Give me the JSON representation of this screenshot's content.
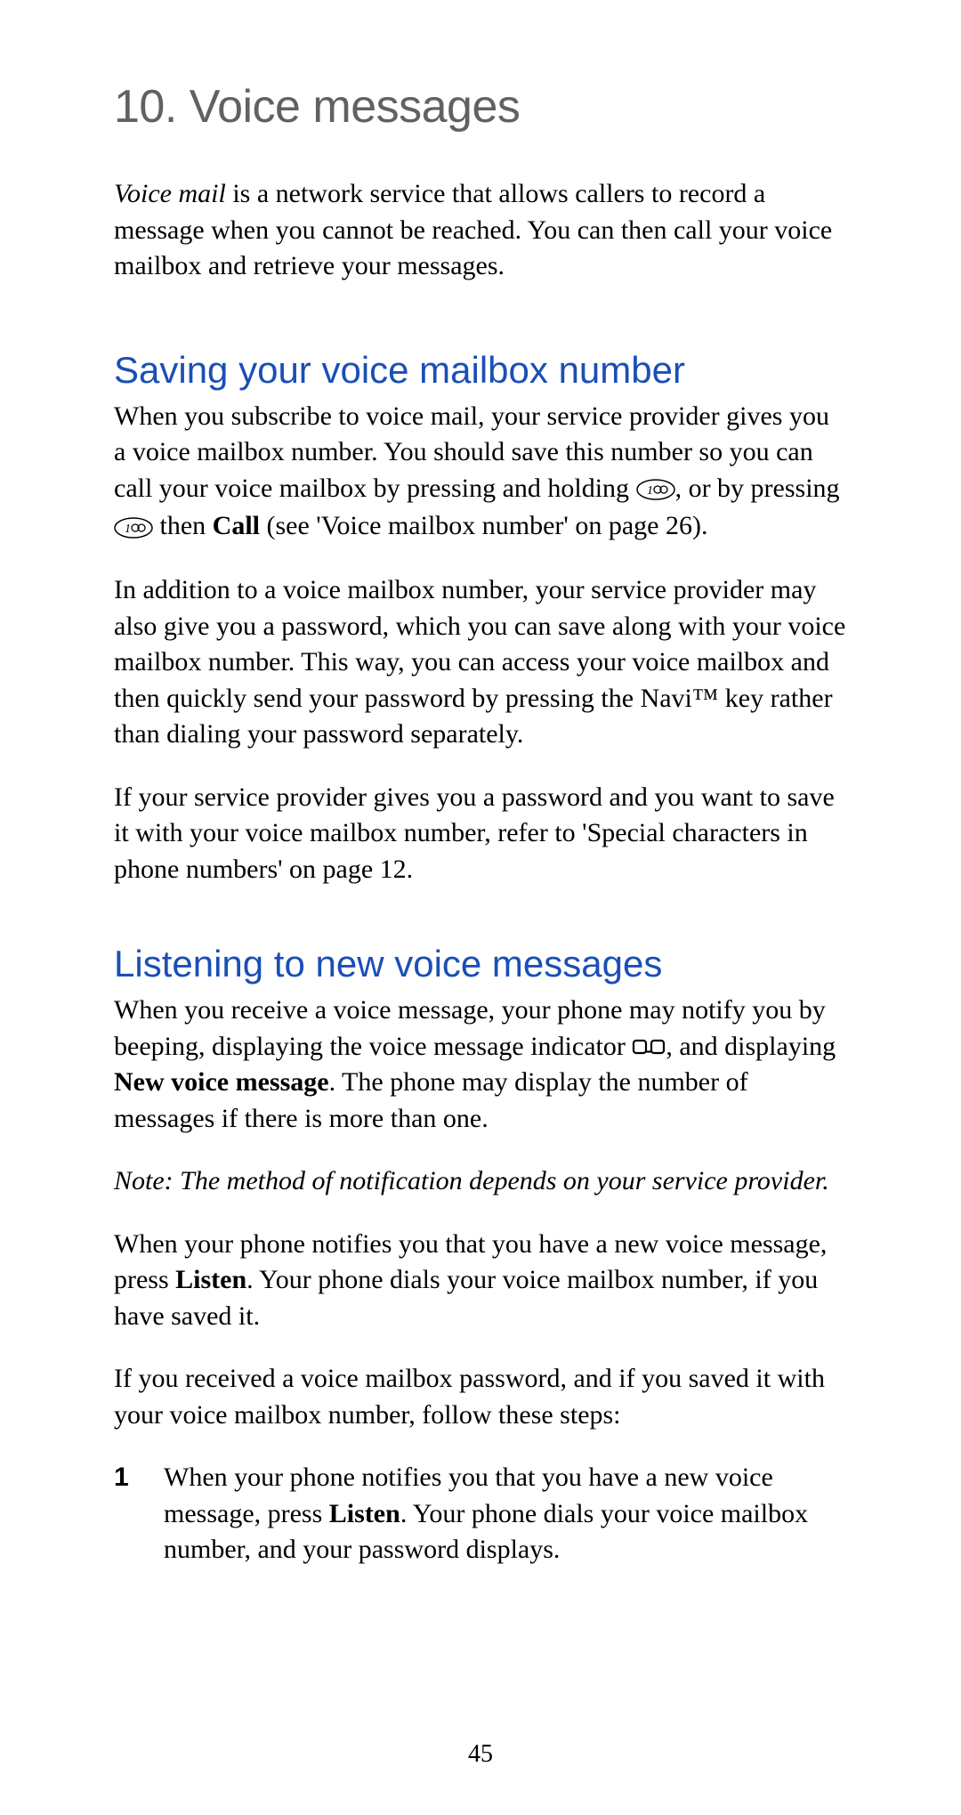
{
  "chapter": {
    "number": "10.",
    "title": "Voice messages"
  },
  "intro": {
    "em_prefix": "Voice mail",
    "text": " is a network service that allows callers to record a message when you cannot be reached. You can then call your voice mailbox and retrieve your messages."
  },
  "section1": {
    "title": "Saving your voice mailbox number",
    "p1_pre": "When you subscribe to voice mail, your service provider gives you a voice mailbox number. You should save this number so you can call your voice mailbox by pressing and holding ",
    "p1_mid": ", or by pressing ",
    "p1_then": " then ",
    "p1_call": "Call",
    "p1_post": " (see 'Voice mailbox number' on page 26).",
    "p2": "In addition to a voice mailbox number, your service provider may also give you a password, which you can save along with your voice mailbox number. This way, you can access your voice mailbox and then quickly send your password by pressing the Navi™ key rather than dialing your password separately.",
    "p3": "If your service provider gives you a password and you want to save it with your voice mailbox number, refer to 'Special characters in phone numbers' on page 12."
  },
  "section2": {
    "title": "Listening to new voice messages",
    "p1_pre": "When you receive a voice message, your phone may notify you by beeping, displaying the voice message indicator ",
    "p1_mid": ", and displaying ",
    "p1_bold": "New voice message",
    "p1_post": ". The phone may display the number of messages if there is more than one.",
    "note": "Note:  The method of notification depends on your service provider.",
    "p2_pre": "When your phone notifies you that you have a new voice message, press ",
    "p2_listen": "Listen",
    "p2_post": ". Your phone dials your voice mailbox number, if you have saved it.",
    "p3": "If you received a voice mailbox password, and if you saved it with your voice mailbox number, follow these steps:",
    "step1_pre": "When your phone notifies you that you have a new voice message, press ",
    "step1_listen": "Listen",
    "step1_post": ". Your phone dials your voice mailbox number, and your password displays."
  },
  "page_number": "45"
}
